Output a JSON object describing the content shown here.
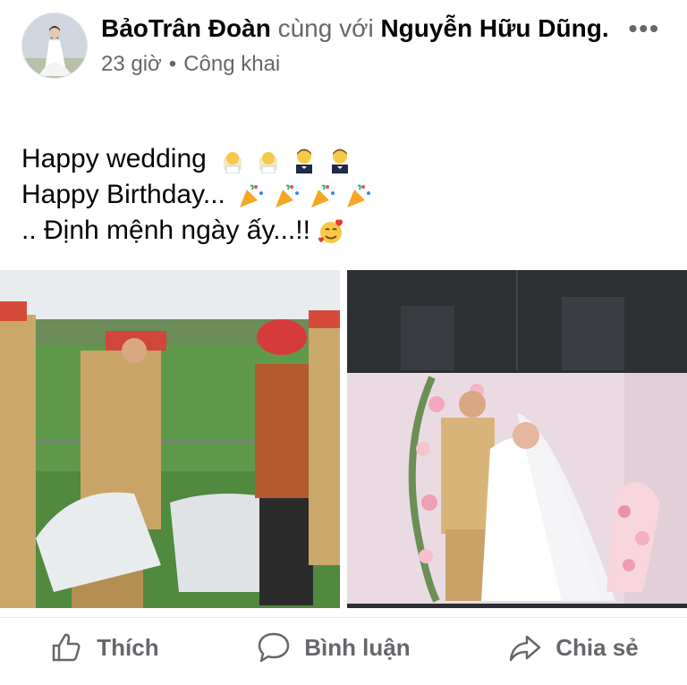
{
  "post": {
    "author": "BảoTrân Đoàn",
    "with_text": "cùng với",
    "tagged": "Nguyễn Hữu Dũng",
    "period": ".",
    "time": "23 giờ",
    "separator": "•",
    "privacy": "Công khai",
    "more_label": "•••",
    "lines": [
      "Happy wedding",
      "Happy Birthday...",
      ".. Định mệnh ngày ấy...!!"
    ]
  },
  "actions": {
    "like": "Thích",
    "comment": "Bình luận",
    "share": "Chia sẻ"
  },
  "colors": {
    "text": "#050505",
    "secondary": "#65676b",
    "divider": "#e4e6eb"
  }
}
